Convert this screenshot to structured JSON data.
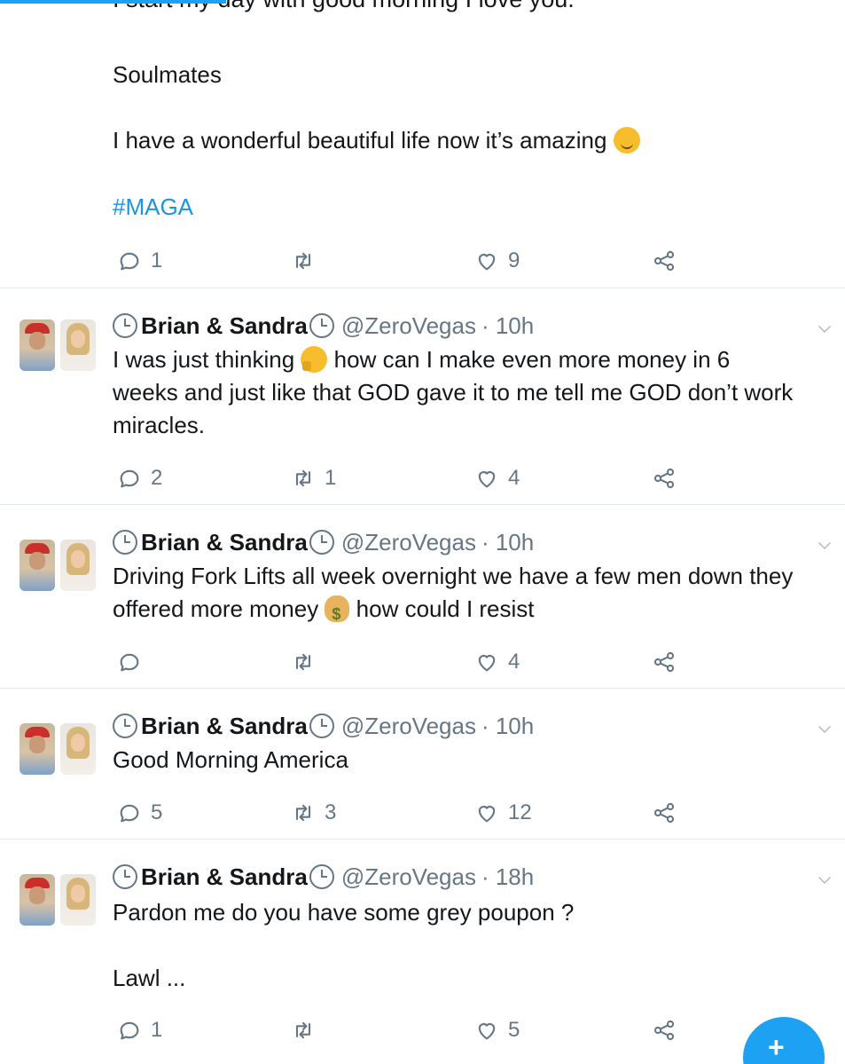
{
  "top_tweet": {
    "cut_line": "I start my day with good morning I love you.",
    "lines": [
      "Soulmates",
      "I have a wonderful beautiful life now it’s amazing"
    ],
    "hashtag": "#MAGA",
    "replies": "1",
    "retweets": "",
    "likes": "9"
  },
  "tweets": [
    {
      "name": "Brian & Sandra",
      "handle": "@ZeroVegas",
      "time": "· 10h",
      "text_before": "I was just thinking ",
      "text_after": " how can I make even more money in 6 weeks and just like that GOD gave it to me tell me GOD don’t work miracles.",
      "replies": "2",
      "retweets": "1",
      "likes": "4"
    },
    {
      "name": "Brian & Sandra",
      "handle": "@ZeroVegas",
      "time": "· 10h",
      "text_before": "Driving Fork Lifts all week overnight we have a few men down they offered more money ",
      "text_after": " how could I resist",
      "replies": "",
      "retweets": "",
      "likes": "4"
    },
    {
      "name": "Brian & Sandra",
      "handle": "@ZeroVegas",
      "time": "· 10h",
      "text": "Good Morning America",
      "replies": "5",
      "retweets": "3",
      "likes": "12"
    },
    {
      "name": "Brian & Sandra",
      "handle": "@ZeroVegas",
      "time": "· 18h",
      "text": "Pardon me do you have some grey poupon ?",
      "text2": "Lawl ...",
      "replies": "1",
      "retweets": "",
      "likes": "5"
    }
  ],
  "icons": {
    "reply": "reply-icon",
    "retweet": "retweet-icon",
    "like": "heart-icon",
    "share": "share-icon",
    "compose": "compose-tweet-icon"
  },
  "colors": {
    "accent": "#1da1f2",
    "hashtag": "#1b95e0",
    "muted": "#657786",
    "divider": "#e1e8ed"
  },
  "compose": {
    "label": "+"
  }
}
